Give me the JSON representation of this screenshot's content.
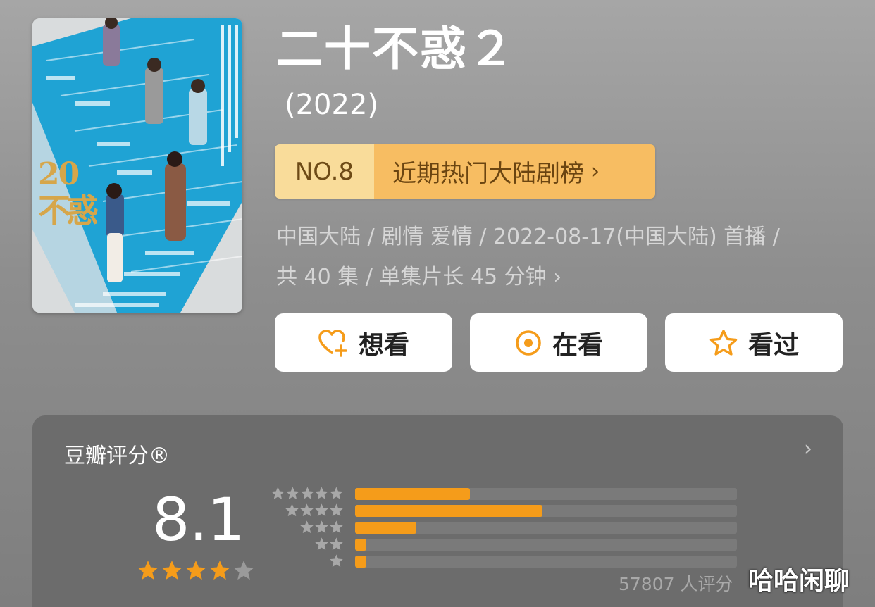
{
  "title": "二十不惑２",
  "year": "(2022)",
  "rank": {
    "number": "NO.8",
    "label": "近期热门大陆剧榜",
    "chevron": "›"
  },
  "meta": {
    "line1": "中国大陆 / 剧情 爱情 / 2022-08-17(中国大陆) 首播 /",
    "line2": "共 40 集 / 单集片长 45 分钟",
    "chevron": "›"
  },
  "actions": [
    {
      "label": "想看",
      "icon": "heart-plus-icon"
    },
    {
      "label": "在看",
      "icon": "circle-dot-icon"
    },
    {
      "label": "看过",
      "icon": "star-outline-icon"
    }
  ],
  "rating": {
    "title": "豆瓣评分®",
    "chevron": "›",
    "score": "8.1",
    "stars": 4,
    "distribution": [
      {
        "stars": 5,
        "fraction": 0.3
      },
      {
        "stars": 4,
        "fraction": 0.49
      },
      {
        "stars": 3,
        "fraction": 0.16
      },
      {
        "stars": 2,
        "fraction": 0.03
      },
      {
        "stars": 1,
        "fraction": 0.03
      }
    ],
    "count": "57807 人评分"
  },
  "poster": {
    "logo_top": "20",
    "logo_bottom": "不惑"
  },
  "watermark": "哈哈闲聊",
  "colors": {
    "accent": "#f59c1a",
    "rank_left": "#f9dc9a",
    "rank_right": "#f7bd62",
    "card": "#6c6c6c"
  }
}
